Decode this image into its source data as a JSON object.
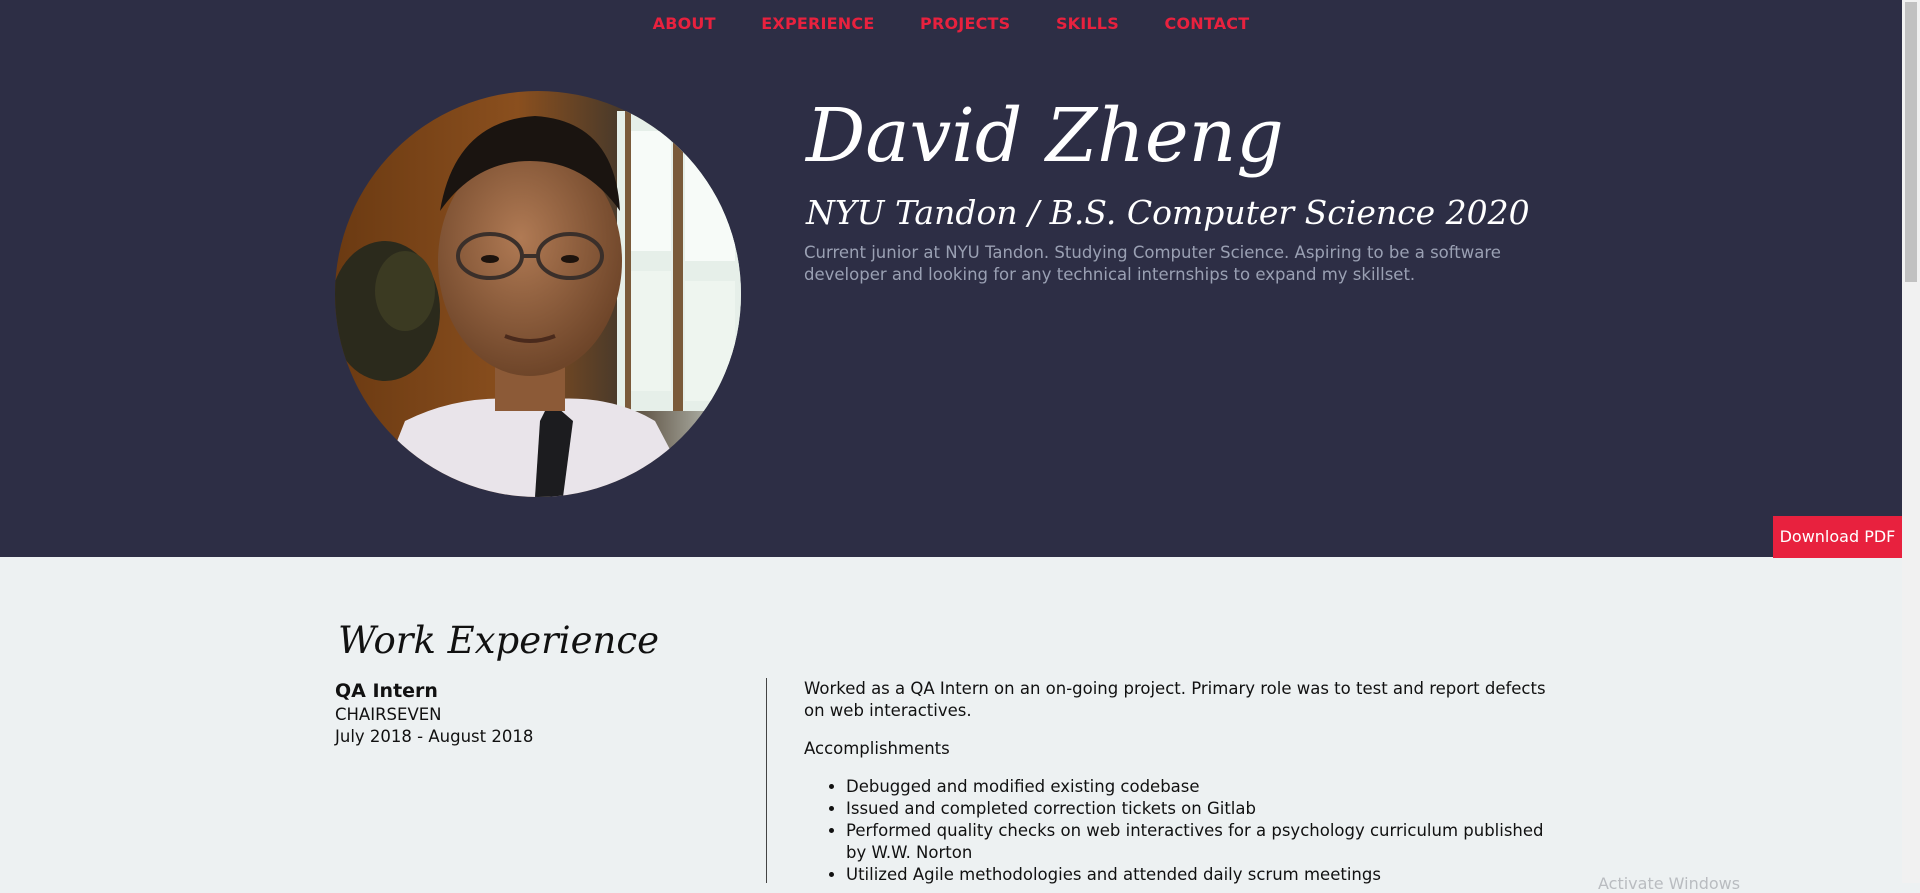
{
  "nav": {
    "items": [
      "ABOUT",
      "EXPERIENCE",
      "PROJECTS",
      "SKILLS",
      "CONTACT"
    ]
  },
  "hero": {
    "name": "David Zheng",
    "subtitle": "NYU Tandon / B.S. Computer Science 2020",
    "bio": "Current junior at NYU Tandon. Studying Computer Science. Aspiring to be a software developer and looking for any technical internships to expand my skillset.",
    "download_label": "Download PDF"
  },
  "work": {
    "section_title": "Work Experience",
    "jobs": [
      {
        "title": "QA Intern",
        "company": "CHAIRSEVEN",
        "dates": "July 2018 - August 2018",
        "description": "Worked as a QA Intern on an on-going project. Primary role was to test and report defects on web interactives.",
        "accomplishments_label": "Accomplishments",
        "accomplishments": [
          "Debugged and modified existing codebase",
          "Issued and completed correction tickets on Gitlab",
          "Performed quality checks on web interactives for a psychology curriculum published by W.W. Norton",
          "Utilized Agile methodologies and attended daily scrum meetings"
        ]
      }
    ]
  },
  "watermark": "Activate Windows",
  "colors": {
    "hero_bg": "#2d2e45",
    "accent": "#e8213e",
    "page_bg": "#edf1f2",
    "bio_text": "#9aa0b3"
  }
}
